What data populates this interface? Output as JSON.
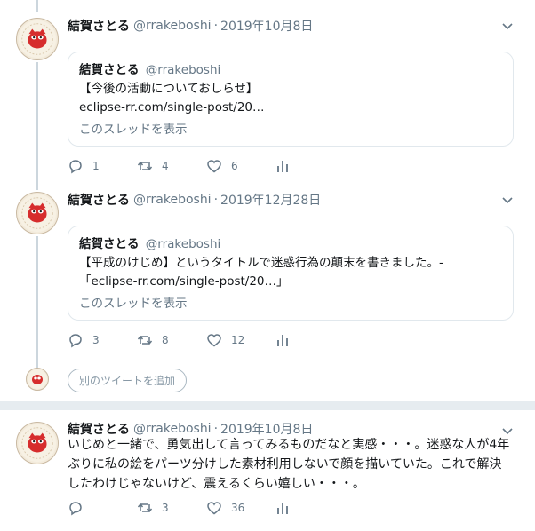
{
  "tweets": [
    {
      "name": "結賀さとる",
      "handle": "@rrakeboshi",
      "sep": "·",
      "date": "2019年10月8日",
      "quote": {
        "name": "結賀さとる",
        "handle": "@rrakeboshi",
        "line1": "【今後の活動についておしらせ】",
        "line2": "eclipse-rr.com/single-post/20…",
        "show_thread": "このスレッドを表示"
      },
      "replies": "1",
      "retweets": "4",
      "likes": "6"
    },
    {
      "name": "結賀さとる",
      "handle": "@rrakeboshi",
      "sep": "·",
      "date": "2019年12月28日",
      "quote": {
        "name": "結賀さとる",
        "handle": "@rrakeboshi",
        "line1": "【平成のけじめ】というタイトルで迷惑行為の顛末を書きました。-",
        "line2": "「eclipse-rr.com/single-post/20…」",
        "show_thread": "このスレッドを表示"
      },
      "replies": "3",
      "retweets": "8",
      "likes": "12"
    }
  ],
  "add_tweet_label": "別のツイートを追加",
  "standalone": {
    "name": "結賀さとる",
    "handle": "@rrakeboshi",
    "sep": "·",
    "date": "2019年10月8日",
    "text_line1": "いじめと一緒で、勇気出して言ってみるものだなと実感・・・。迷惑な人が4年",
    "text_line2": "ぶりに私の絵をパーツ分けした素材利用しないで顔を描いていた。これで解決",
    "text_line3": "したわけじゃないけど、震えるくらい嬉しい・・・。",
    "replies": "",
    "retweets": "3",
    "likes": "36"
  },
  "colors": {
    "muted": "#657786",
    "border": "#e1e8ed",
    "thread": "#ccd6dd",
    "divider": "#e6ecf0"
  },
  "icons": [
    "reply-icon",
    "retweet-icon",
    "like-icon",
    "stats-icon",
    "chevron-down-icon"
  ]
}
